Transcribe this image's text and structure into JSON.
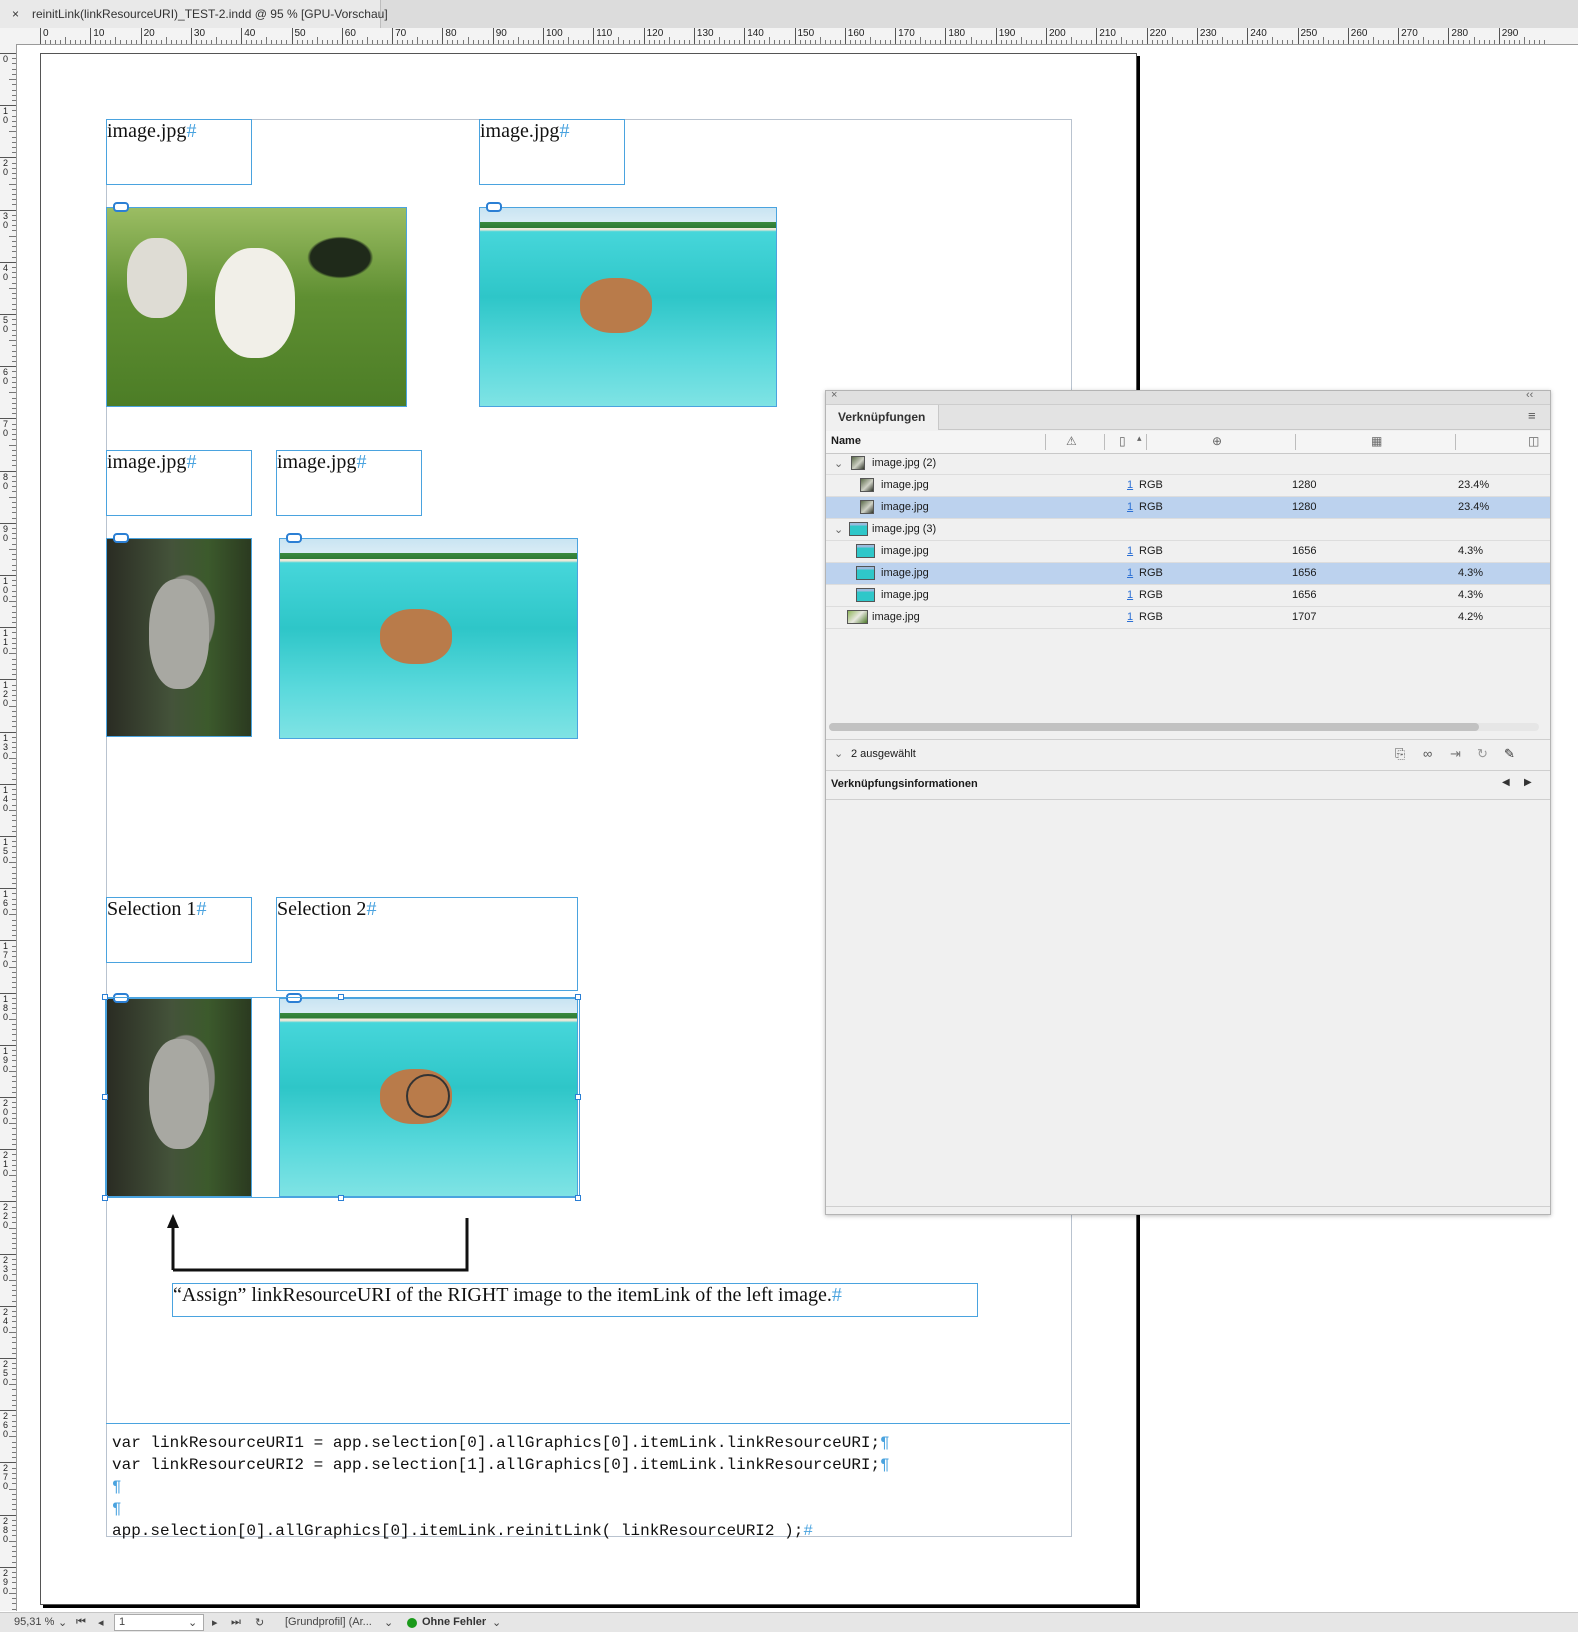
{
  "window": {
    "tab_close": "×",
    "tab_title": "reinitLink(linkResourceURI)_TEST-2.indd @ 95 % [GPU-Vorschau]"
  },
  "ruler": {
    "h_labels": [
      "0",
      "10",
      "20",
      "30",
      "40",
      "50",
      "60",
      "70",
      "80",
      "90",
      "100",
      "110",
      "120",
      "130",
      "140",
      "150",
      "160",
      "170",
      "180",
      "190",
      "200",
      "210",
      "220",
      "230",
      "240",
      "250",
      "260",
      "270",
      "280",
      "290"
    ],
    "v_labels": [
      "0",
      "10",
      "20",
      "30",
      "40",
      "50",
      "60",
      "70",
      "80",
      "90",
      "100",
      "110",
      "120",
      "130",
      "140",
      "150",
      "160",
      "170",
      "180",
      "190",
      "200",
      "210",
      "220",
      "230",
      "240",
      "250",
      "260",
      "270",
      "280",
      "290"
    ]
  },
  "document": {
    "caption_1": "image.jpg",
    "caption_2": "image.jpg",
    "caption_3": "image.jpg",
    "caption_4": "image.jpg",
    "selection_1": "Selection 1",
    "selection_2": "Selection 2",
    "hash": "#",
    "assign_note": "“Assign” linkResourceURI of the RIGHT image to the itemLink of the left image.",
    "code_lines": [
      "var linkResourceURI1 = app.selection[0].allGraphics[0].itemLink.linkResourceURI;",
      "var linkResourceURI2 = app.selection[1].allGraphics[0].itemLink.linkResourceURI;",
      "",
      "",
      "app.selection[0].allGraphics[0].itemLink.reinitLink( linkResourceURI2 );"
    ],
    "pilcrow": "¶",
    "end_mark": "#"
  },
  "links_panel": {
    "tab_label": "Verknüpfungen",
    "col_name": "Name",
    "groups": [
      {
        "label": "image.jpg (2)",
        "rows": [
          {
            "name": "image.jpg",
            "page": "1",
            "color": "RGB",
            "ppi": "1280",
            "scale": "23.4%",
            "selected": false
          },
          {
            "name": "image.jpg",
            "page": "1",
            "color": "RGB",
            "ppi": "1280",
            "scale": "23.4%",
            "selected": true
          }
        ]
      },
      {
        "label": "image.jpg (3)",
        "rows": [
          {
            "name": "image.jpg",
            "page": "1",
            "color": "RGB",
            "ppi": "1656",
            "scale": "4.3%",
            "selected": false
          },
          {
            "name": "image.jpg",
            "page": "1",
            "color": "RGB",
            "ppi": "1656",
            "scale": "4.3%",
            "selected": true
          },
          {
            "name": "image.jpg",
            "page": "1",
            "color": "RGB",
            "ppi": "1656",
            "scale": "4.3%",
            "selected": false
          }
        ]
      }
    ],
    "single": {
      "name": "image.jpg",
      "page": "1",
      "color": "RGB",
      "ppi": "1707",
      "scale": "4.2%"
    },
    "selected_count": "2 ausgewählt",
    "info_title": "Verknüpfungsinformationen",
    "selection_color": "#bcd2ee"
  },
  "statusbar": {
    "zoom": "95,31 %",
    "page": "1",
    "profile": "[Grundprofil] (Ar...",
    "preflight": "Ohne Fehler",
    "preflight_color": "#1a9a1a"
  }
}
